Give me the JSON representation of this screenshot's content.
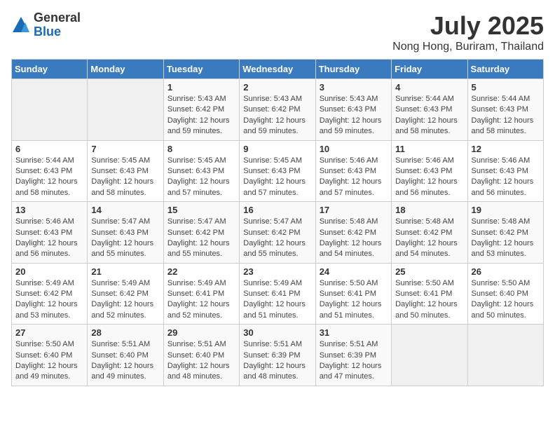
{
  "header": {
    "logo_general": "General",
    "logo_blue": "Blue",
    "month_title": "July 2025",
    "location": "Nong Hong, Buriram, Thailand"
  },
  "days_of_week": [
    "Sunday",
    "Monday",
    "Tuesday",
    "Wednesday",
    "Thursday",
    "Friday",
    "Saturday"
  ],
  "weeks": [
    [
      {
        "day": "",
        "info": ""
      },
      {
        "day": "",
        "info": ""
      },
      {
        "day": "1",
        "info": "Sunrise: 5:43 AM\nSunset: 6:42 PM\nDaylight: 12 hours and 59 minutes."
      },
      {
        "day": "2",
        "info": "Sunrise: 5:43 AM\nSunset: 6:42 PM\nDaylight: 12 hours and 59 minutes."
      },
      {
        "day": "3",
        "info": "Sunrise: 5:43 AM\nSunset: 6:43 PM\nDaylight: 12 hours and 59 minutes."
      },
      {
        "day": "4",
        "info": "Sunrise: 5:44 AM\nSunset: 6:43 PM\nDaylight: 12 hours and 58 minutes."
      },
      {
        "day": "5",
        "info": "Sunrise: 5:44 AM\nSunset: 6:43 PM\nDaylight: 12 hours and 58 minutes."
      }
    ],
    [
      {
        "day": "6",
        "info": "Sunrise: 5:44 AM\nSunset: 6:43 PM\nDaylight: 12 hours and 58 minutes."
      },
      {
        "day": "7",
        "info": "Sunrise: 5:45 AM\nSunset: 6:43 PM\nDaylight: 12 hours and 58 minutes."
      },
      {
        "day": "8",
        "info": "Sunrise: 5:45 AM\nSunset: 6:43 PM\nDaylight: 12 hours and 57 minutes."
      },
      {
        "day": "9",
        "info": "Sunrise: 5:45 AM\nSunset: 6:43 PM\nDaylight: 12 hours and 57 minutes."
      },
      {
        "day": "10",
        "info": "Sunrise: 5:46 AM\nSunset: 6:43 PM\nDaylight: 12 hours and 57 minutes."
      },
      {
        "day": "11",
        "info": "Sunrise: 5:46 AM\nSunset: 6:43 PM\nDaylight: 12 hours and 56 minutes."
      },
      {
        "day": "12",
        "info": "Sunrise: 5:46 AM\nSunset: 6:43 PM\nDaylight: 12 hours and 56 minutes."
      }
    ],
    [
      {
        "day": "13",
        "info": "Sunrise: 5:46 AM\nSunset: 6:43 PM\nDaylight: 12 hours and 56 minutes."
      },
      {
        "day": "14",
        "info": "Sunrise: 5:47 AM\nSunset: 6:43 PM\nDaylight: 12 hours and 55 minutes."
      },
      {
        "day": "15",
        "info": "Sunrise: 5:47 AM\nSunset: 6:42 PM\nDaylight: 12 hours and 55 minutes."
      },
      {
        "day": "16",
        "info": "Sunrise: 5:47 AM\nSunset: 6:42 PM\nDaylight: 12 hours and 55 minutes."
      },
      {
        "day": "17",
        "info": "Sunrise: 5:48 AM\nSunset: 6:42 PM\nDaylight: 12 hours and 54 minutes."
      },
      {
        "day": "18",
        "info": "Sunrise: 5:48 AM\nSunset: 6:42 PM\nDaylight: 12 hours and 54 minutes."
      },
      {
        "day": "19",
        "info": "Sunrise: 5:48 AM\nSunset: 6:42 PM\nDaylight: 12 hours and 53 minutes."
      }
    ],
    [
      {
        "day": "20",
        "info": "Sunrise: 5:49 AM\nSunset: 6:42 PM\nDaylight: 12 hours and 53 minutes."
      },
      {
        "day": "21",
        "info": "Sunrise: 5:49 AM\nSunset: 6:42 PM\nDaylight: 12 hours and 52 minutes."
      },
      {
        "day": "22",
        "info": "Sunrise: 5:49 AM\nSunset: 6:41 PM\nDaylight: 12 hours and 52 minutes."
      },
      {
        "day": "23",
        "info": "Sunrise: 5:49 AM\nSunset: 6:41 PM\nDaylight: 12 hours and 51 minutes."
      },
      {
        "day": "24",
        "info": "Sunrise: 5:50 AM\nSunset: 6:41 PM\nDaylight: 12 hours and 51 minutes."
      },
      {
        "day": "25",
        "info": "Sunrise: 5:50 AM\nSunset: 6:41 PM\nDaylight: 12 hours and 50 minutes."
      },
      {
        "day": "26",
        "info": "Sunrise: 5:50 AM\nSunset: 6:40 PM\nDaylight: 12 hours and 50 minutes."
      }
    ],
    [
      {
        "day": "27",
        "info": "Sunrise: 5:50 AM\nSunset: 6:40 PM\nDaylight: 12 hours and 49 minutes."
      },
      {
        "day": "28",
        "info": "Sunrise: 5:51 AM\nSunset: 6:40 PM\nDaylight: 12 hours and 49 minutes."
      },
      {
        "day": "29",
        "info": "Sunrise: 5:51 AM\nSunset: 6:40 PM\nDaylight: 12 hours and 48 minutes."
      },
      {
        "day": "30",
        "info": "Sunrise: 5:51 AM\nSunset: 6:39 PM\nDaylight: 12 hours and 48 minutes."
      },
      {
        "day": "31",
        "info": "Sunrise: 5:51 AM\nSunset: 6:39 PM\nDaylight: 12 hours and 47 minutes."
      },
      {
        "day": "",
        "info": ""
      },
      {
        "day": "",
        "info": ""
      }
    ]
  ]
}
